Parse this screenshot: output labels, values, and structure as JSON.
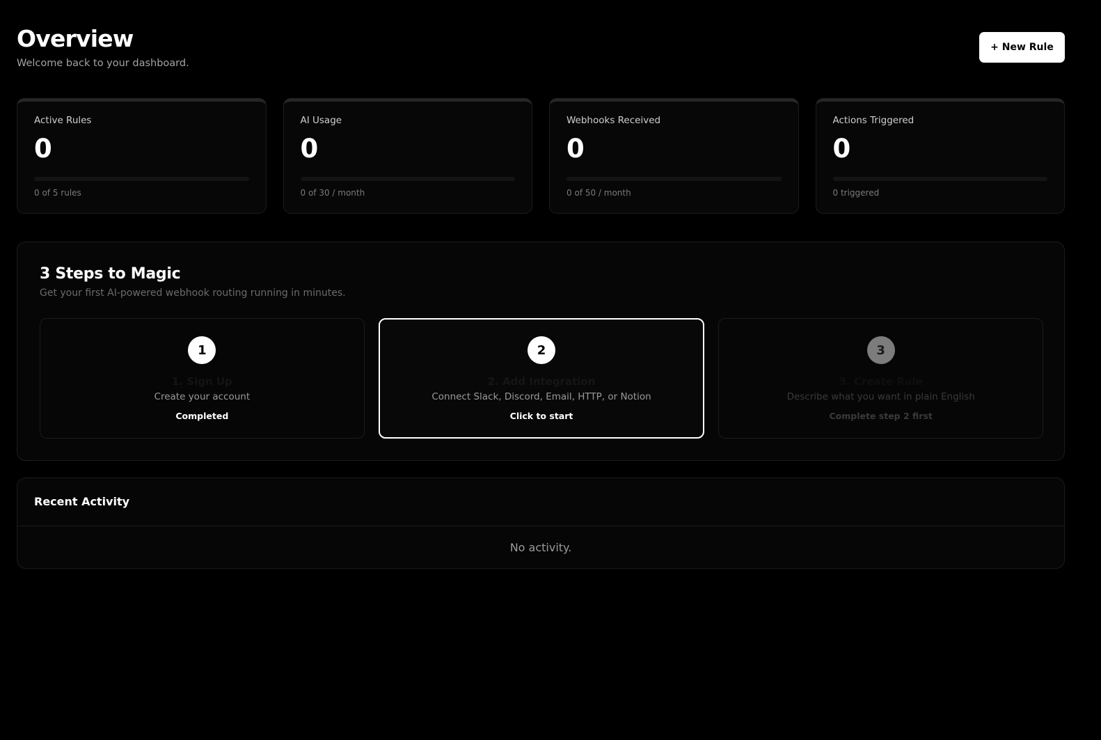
{
  "header": {
    "title": "Overview",
    "subtitle": "Welcome back to your dashboard.",
    "new_rule_label": "+ New Rule"
  },
  "stats": [
    {
      "label": "Active Rules",
      "value": "0",
      "footer": "0 of 5 rules",
      "progress": 0
    },
    {
      "label": "AI Usage",
      "value": "0",
      "footer": "0 of 30 / month",
      "progress": 0
    },
    {
      "label": "Webhooks Received",
      "value": "0",
      "footer": "0 of 50 / month",
      "progress": 0
    },
    {
      "label": "Actions Triggered",
      "value": "0",
      "footer": "0 triggered",
      "progress": 0
    }
  ],
  "steps": {
    "title": "3 Steps to Magic",
    "subtitle": "Get your first AI-powered webhook routing running in minutes.",
    "items": [
      {
        "number": "1",
        "title": "1. Sign Up",
        "description": "Create your account",
        "status": "Completed"
      },
      {
        "number": "2",
        "title": "2. Add Integration",
        "description": "Connect Slack, Discord, Email, HTTP, or Notion",
        "status": "Click to start"
      },
      {
        "number": "3",
        "title": "3. Create Rule",
        "description": "Describe what you want in plain English",
        "status": "Complete step 2 first"
      }
    ]
  },
  "activity": {
    "title": "Recent Activity",
    "empty_text": "No activity."
  }
}
